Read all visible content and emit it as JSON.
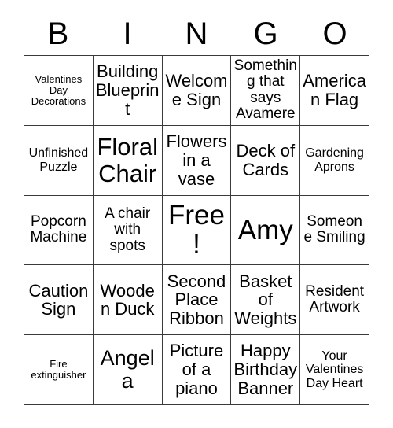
{
  "card": {
    "title_letters": [
      "B",
      "I",
      "N",
      "G",
      "O"
    ],
    "grid": {
      "columns": 5,
      "rows": 5,
      "border_color": "#3a3a3a",
      "background_color": "#ffffff",
      "text_color": "#000000"
    },
    "cells": [
      {
        "text": "Valentines Day Decorations",
        "size": "fs-xs"
      },
      {
        "text": "Building Blueprint",
        "size": "fs-l"
      },
      {
        "text": "Welcome Sign",
        "size": "fs-l"
      },
      {
        "text": "Something that says Avamere",
        "size": "fs-m"
      },
      {
        "text": "American Flag",
        "size": "fs-l"
      },
      {
        "text": "Unfinished Puzzle",
        "size": "fs-s"
      },
      {
        "text": "Floral Chair",
        "size": "fs-xxl"
      },
      {
        "text": "Flowers in a vase",
        "size": "fs-l"
      },
      {
        "text": "Deck of Cards",
        "size": "fs-l"
      },
      {
        "text": "Gardening Aprons",
        "size": "fs-s"
      },
      {
        "text": "Popcorn Machine",
        "size": "fs-m"
      },
      {
        "text": "A chair with spots",
        "size": "fs-m"
      },
      {
        "text": "Free!",
        "size": "fs-huge"
      },
      {
        "text": "Amy",
        "size": "fs-huge"
      },
      {
        "text": "Someone Smiling",
        "size": "fs-m"
      },
      {
        "text": "Caution Sign",
        "size": "fs-l"
      },
      {
        "text": "Wooden Duck",
        "size": "fs-l"
      },
      {
        "text": "Second Place Ribbon",
        "size": "fs-l"
      },
      {
        "text": "Basket of Weights",
        "size": "fs-l"
      },
      {
        "text": "Resident Artwork",
        "size": "fs-m"
      },
      {
        "text": "Fire extinguisher",
        "size": "fs-xs"
      },
      {
        "text": "Angela",
        "size": "fs-xl"
      },
      {
        "text": "Picture of a piano",
        "size": "fs-l"
      },
      {
        "text": "Happy Birthday Banner",
        "size": "fs-l"
      },
      {
        "text": "Your Valentines Day Heart",
        "size": "fs-s"
      }
    ]
  }
}
